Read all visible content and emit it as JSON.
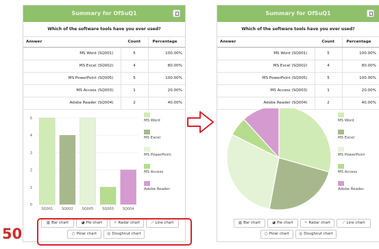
{
  "header": {
    "title": "Summary for OfSuQ1"
  },
  "question": "Which of the software tools have you ever used?",
  "table": {
    "columns": [
      "Answer",
      "Count",
      "Percentage"
    ],
    "rows": [
      {
        "answer": "MS Word (SQ001)",
        "count": "5",
        "percentage": "100.00%"
      },
      {
        "answer": "MS Excel (SQ002)",
        "count": "4",
        "percentage": "80.00%"
      },
      {
        "answer": "MS PowerPoint (SQ005)",
        "count": "5",
        "percentage": "100.00%"
      },
      {
        "answer": "MS Access (SQ003)",
        "count": "1",
        "percentage": "20.00%"
      },
      {
        "answer": "Adobe Reader (SQ004)",
        "count": "2",
        "percentage": "40.00%"
      }
    ]
  },
  "legend": [
    {
      "label": "MS Word",
      "color": "#d1ebb6"
    },
    {
      "label": "MS Excel",
      "color": "#a7b98c"
    },
    {
      "label": "MS PowerPoint",
      "color": "#e4f3d6"
    },
    {
      "label": "MS Access",
      "color": "#b5dd8d"
    },
    {
      "label": "Adobe Reader",
      "color": "#d59bd0"
    }
  ],
  "buttons": {
    "bar": "Bar chart",
    "pie": "Pie chart",
    "radar": "Radar chart",
    "line": "Line chart",
    "polar": "Polar chart",
    "doughnut": "Doughnut chart"
  },
  "icons": {
    "header": "export-icon",
    "bar": "bar-chart-icon",
    "pie": "pie-chart-icon",
    "radar": "radar-chart-icon",
    "line": "line-chart-icon",
    "polar": "polar-chart-icon",
    "doughnut": "doughnut-chart-icon",
    "arrow": "arrow-right-icon"
  },
  "colors": {
    "header": "#8fc06a",
    "highlight": "#d8202a",
    "step": "#cf2a27",
    "border": "#e0e0e0"
  },
  "step_number": "50",
  "chart_data": [
    {
      "type": "bar",
      "categories": [
        "SQ001",
        "SQ002",
        "SQ005",
        "SQ003",
        "SQ004"
      ],
      "values": [
        5,
        4,
        5,
        1,
        2
      ],
      "colors": [
        "#d1ebb6",
        "#a7b98c",
        "#e4f3d6",
        "#b5dd8d",
        "#d59bd0"
      ],
      "yticks": [
        0,
        1,
        2,
        3,
        4,
        5
      ],
      "ylim": [
        0,
        5
      ],
      "legend_position": "right"
    },
    {
      "type": "pie",
      "categories": [
        "MS Word",
        "MS Excel",
        "MS PowerPoint",
        "MS Access",
        "Adobe Reader"
      ],
      "values": [
        5,
        4,
        5,
        1,
        2
      ],
      "colors": [
        "#d1ebb6",
        "#a7b98c",
        "#e4f3d6",
        "#b5dd8d",
        "#d59bd0"
      ],
      "legend_position": "right"
    }
  ]
}
